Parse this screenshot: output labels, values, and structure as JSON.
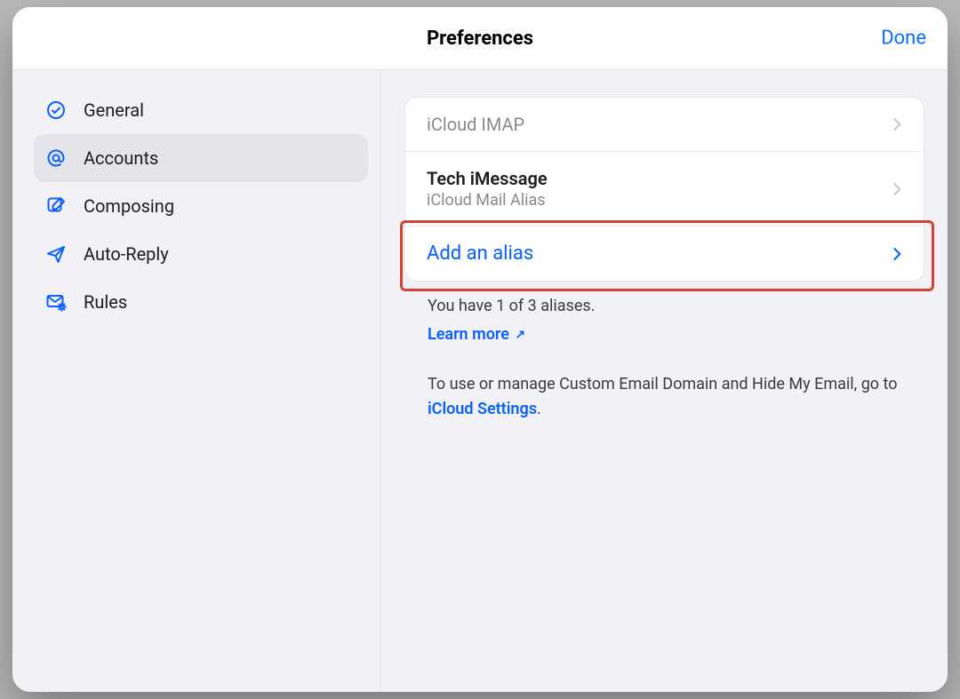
{
  "header": {
    "title": "Preferences",
    "done": "Done"
  },
  "sidebar": {
    "items": [
      {
        "label": "General",
        "icon": "check-circle-icon",
        "selected": false
      },
      {
        "label": "Accounts",
        "icon": "at-icon",
        "selected": true
      },
      {
        "label": "Composing",
        "icon": "compose-icon",
        "selected": false
      },
      {
        "label": "Auto-Reply",
        "icon": "paper-plane-icon",
        "selected": false
      },
      {
        "label": "Rules",
        "icon": "envelope-gear-icon",
        "selected": false
      }
    ]
  },
  "accounts": {
    "rows": [
      {
        "title": "iCloud IMAP",
        "subtitle": null,
        "link": false,
        "dim": true
      },
      {
        "title": "Tech iMessage",
        "subtitle": "iCloud Mail Alias",
        "link": false,
        "dim": false
      },
      {
        "title": "Add an alias",
        "subtitle": null,
        "link": true,
        "dim": false
      }
    ],
    "highlight_row_index": 2
  },
  "info": {
    "alias_status": "You have 1 of 3 aliases.",
    "learn_more": "Learn more",
    "custom_text_prefix": "To use or manage Custom Email Domain and Hide My Email, go to ",
    "settings_link": "iCloud Settings",
    "custom_text_suffix": "."
  }
}
